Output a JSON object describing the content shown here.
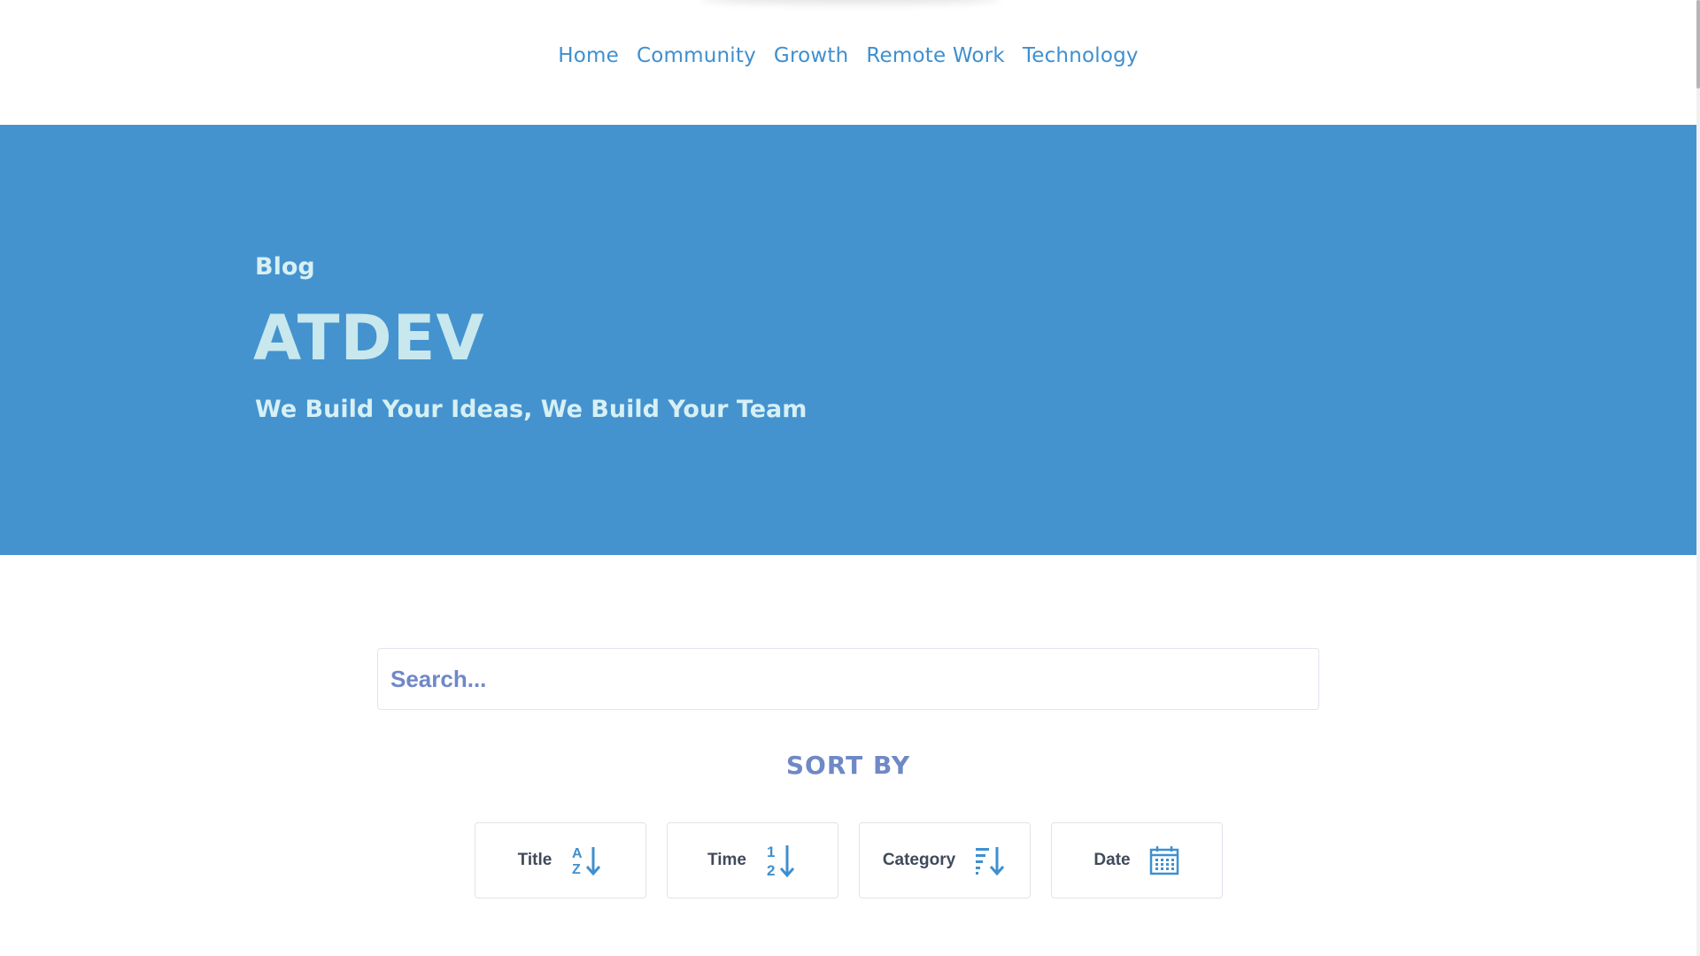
{
  "nav": {
    "items": [
      {
        "label": "Home"
      },
      {
        "label": "Community"
      },
      {
        "label": "Growth"
      },
      {
        "label": "Remote Work"
      },
      {
        "label": "Technology"
      }
    ]
  },
  "hero": {
    "kicker": "Blog",
    "title": "ATDEV",
    "subtitle": "We Build Your Ideas, We Build Your Team"
  },
  "search": {
    "placeholder": "Search..."
  },
  "sort": {
    "heading": "SORT BY",
    "buttons": [
      {
        "label": "Title",
        "icon": "sort-alpha-down-icon"
      },
      {
        "label": "Time",
        "icon": "sort-numeric-down-icon"
      },
      {
        "label": "Category",
        "icon": "sort-amount-down-icon"
      },
      {
        "label": "Date",
        "icon": "calendar-icon"
      }
    ]
  },
  "colors": {
    "hero_bg": "#4493cf",
    "nav_link": "#3f8fcf",
    "accent_muted": "#6f88c6",
    "icon_blue": "#3f8fcf"
  }
}
